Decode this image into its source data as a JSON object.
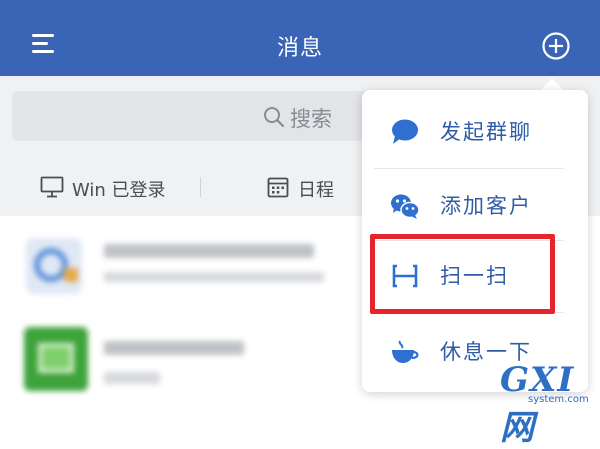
{
  "header": {
    "title": "消息",
    "background_color": "#3a64b6",
    "left_icon": "menu-icon",
    "right_icon": "add-icon"
  },
  "search": {
    "placeholder": "搜索",
    "icon": "search-icon"
  },
  "status_bar": {
    "login_status": "Win 已登录",
    "schedule": "日程",
    "icons": [
      "monitor-icon",
      "calendar-icon"
    ]
  },
  "dropdown_menu": {
    "accent_color": "#2f5ca8",
    "items": [
      {
        "label": "发起群聊",
        "icon": "chat-bubble-icon"
      },
      {
        "label": "添加客户",
        "icon": "wechat-icon"
      },
      {
        "label": "扫一扫",
        "icon": "scan-icon",
        "highlighted": true
      },
      {
        "label": "休息一下",
        "icon": "coffee-cup-icon"
      }
    ],
    "highlight_color": "#e5252b"
  },
  "watermark": {
    "logo": "GXI网",
    "domain": "system.com"
  }
}
